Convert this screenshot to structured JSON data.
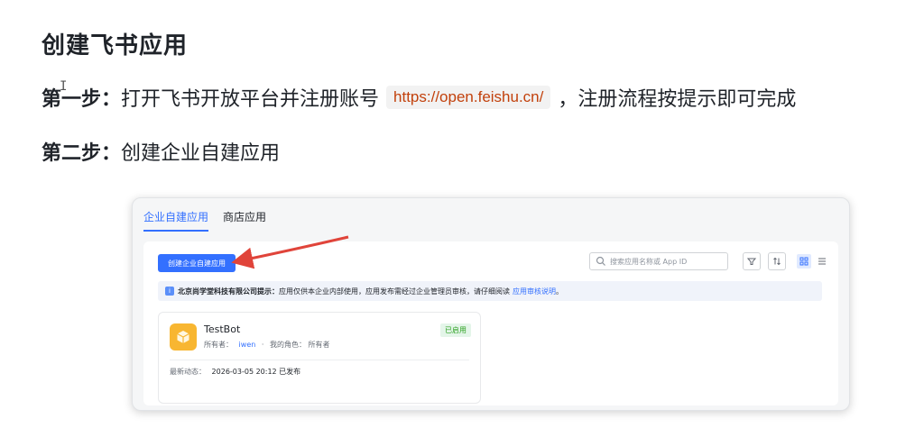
{
  "doc": {
    "title": "创建飞书应用",
    "step1_label": "第一步：",
    "step1_text": "打开飞书开放平台并注册账号",
    "step1_url": "https://open.feishu.cn/",
    "step1_suffix": "，注册流程按提示即可完成",
    "step2_label": "第二步：",
    "step2_text": "创建企业自建应用"
  },
  "console": {
    "tabs": [
      {
        "label": "企业自建应用",
        "active": true
      },
      {
        "label": "商店应用",
        "active": false
      }
    ],
    "create_button": "创建企业自建应用",
    "search_placeholder": "搜索应用名称或 App ID",
    "notice": {
      "company": "北京尚学堂科技有限公司提示：",
      "text": "应用仅供本企业内部使用，应用发布需经过企业管理员审核，请仔细阅读",
      "link": "应用审核说明",
      "end": "。"
    },
    "app": {
      "name": "TestBot",
      "status": "已启用",
      "owner_label": "所有者：",
      "owner": "iwen",
      "separator": "·",
      "role_label": "我的角色：",
      "role": "所有者",
      "activity_label": "最新动态：",
      "activity": "2026-03-05 20:12 已发布"
    }
  },
  "colors": {
    "accent": "#3370ff",
    "arrow": "#e0443a",
    "app_icon": "#f8b631",
    "status_green": "#2ea121"
  },
  "icons": {
    "search": "search-icon",
    "filter": "filter-icon",
    "sort": "sort-icon",
    "grid": "grid-view-icon",
    "list": "list-view-icon",
    "app": "cube-icon",
    "notice": "info-icon"
  }
}
